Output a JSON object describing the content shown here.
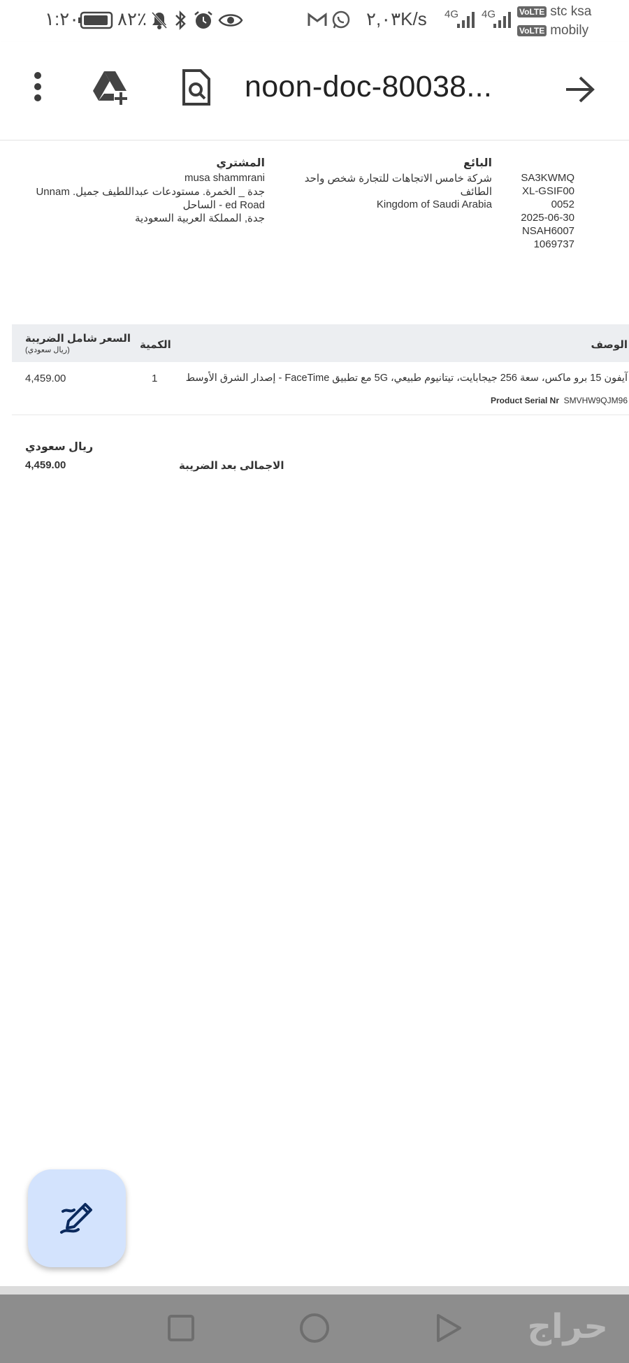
{
  "status_bar": {
    "time": "١:٢٠",
    "battery": "٨٢٪",
    "net_speed": "٢,٠٣K/s",
    "net_type_1": "4G",
    "net_type_2": "4G",
    "carrier_1": "stc ksa",
    "carrier_2": "mobily",
    "volte_label": "VoLTE"
  },
  "toolbar": {
    "title": "noon-doc-80038..."
  },
  "invoice": {
    "seller": {
      "heading": "البائع",
      "lines": [
        "شركة خامس الاتجاهات للتجارة شخص واحد",
        "الطائف",
        "Kingdom of Saudi Arabia"
      ]
    },
    "buyer": {
      "heading": "المشتري",
      "lines": [
        "musa shammrani",
        "جدة _ الخمرة. مستودعات عبداللطيف جميل. Unnam",
        "ed Road - الساحل",
        "جدة, المملكة العربية السعودية"
      ]
    },
    "ids": [
      "SA3KWMQ",
      "XL-GSIF00",
      "0052",
      "2025-06-30",
      "NSAH6007",
      "1069737"
    ],
    "table": {
      "col_description": "الوصف",
      "col_quantity": "الكمية",
      "col_price": "السعر شامل الضريبة",
      "col_price_unit": "(ريال سعودي)",
      "rows": [
        {
          "description": "آيفون 15 برو ماكس، سعة 256 جيجابايت، تيتانيوم طبيعي، 5G مع تطبيق FaceTime - إصدار الشرق الأوسط",
          "quantity": "1",
          "price": "4,459.00",
          "serial_label": "Product Serial Nr",
          "serial_value": "SMVHW9QJM96"
        }
      ]
    },
    "totals": {
      "currency": "ريال سعودي",
      "label": "الاجمالى بعد الضريبة",
      "value": "4,459.00"
    }
  },
  "watermark": "حراج",
  "colors": {
    "fab_bg": "#d3e3fd",
    "fab_icon": "#0b2a5e",
    "table_header_bg": "#eceef1",
    "nav_bg": "#8d8d8d"
  },
  "icons": {
    "menu": "more-vert-icon",
    "drive": "add-to-drive-icon",
    "search": "find-in-page-icon",
    "forward": "arrow-forward-icon",
    "edit": "draw-edit-icon",
    "nav_recents": "square-icon",
    "nav_home": "circle-icon",
    "nav_back": "triangle-icon"
  }
}
